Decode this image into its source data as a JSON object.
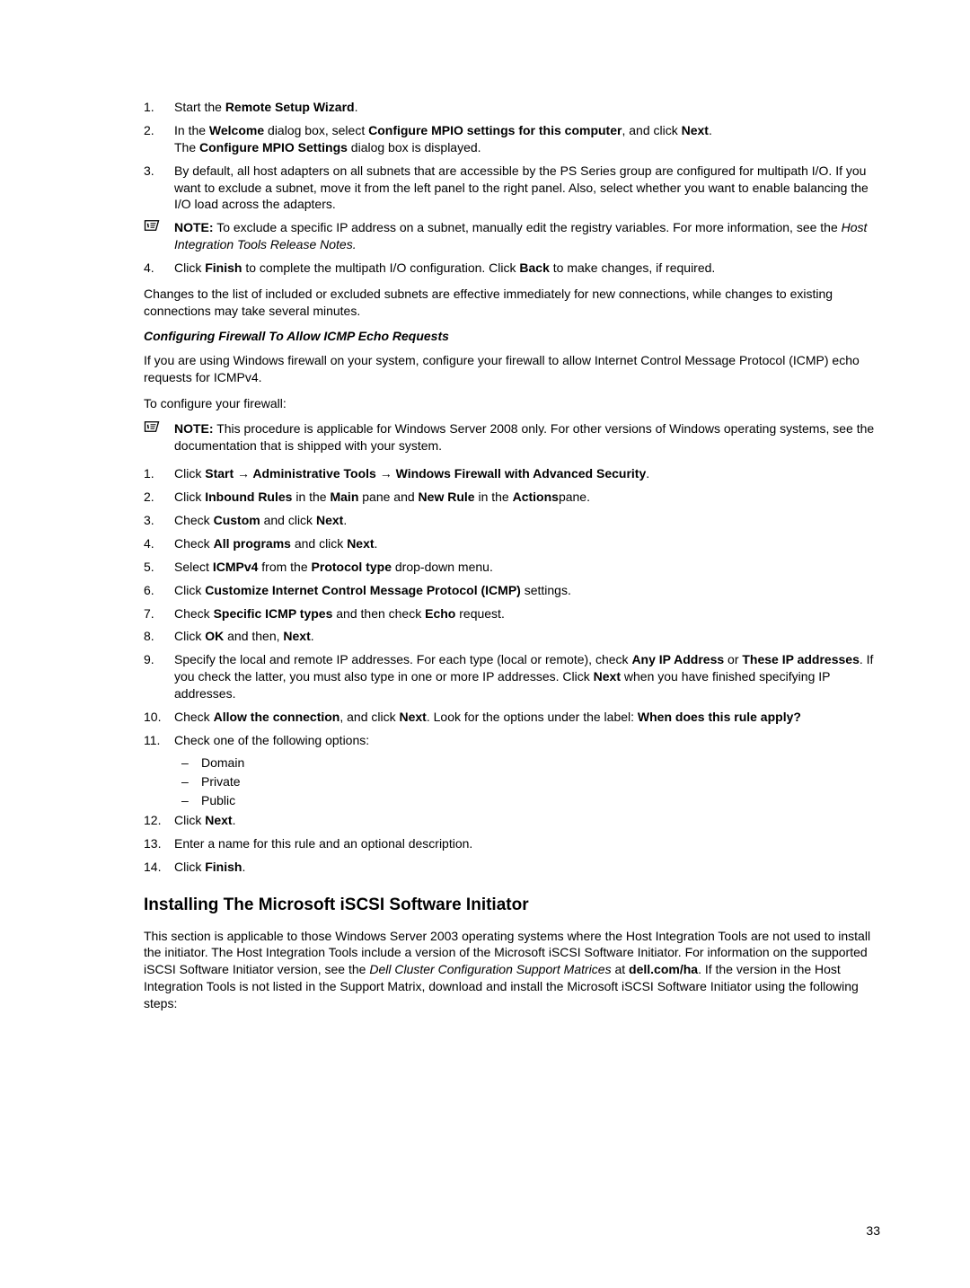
{
  "list_a": [
    {
      "n": "1.",
      "html": "Start the <b>Remote Setup Wizard</b>."
    },
    {
      "n": "2.",
      "html": "In the <b>Welcome</b> dialog box, select <b>Configure MPIO settings for this computer</b>, and click <b>Next</b>.<br>The <b>Configure MPIO Settings</b> dialog box is displayed."
    },
    {
      "n": "3.",
      "html": "By default, all host adapters on all subnets that are accessible by the PS Series group are configured for multipath I/O. If you want to exclude a subnet, move it from the left panel to the right panel. Also, select whether you want to enable balancing the I/O load across the adapters."
    }
  ],
  "note1": "<b>NOTE:</b> To exclude a specific IP address on a subnet, manually edit the registry variables. For more information, see the <span class=\"italic\">Host Integration Tools Release Notes.</span>",
  "list_a2": [
    {
      "n": "4.",
      "html": "Click <b>Finish</b> to complete the multipath I/O configuration. Click <b>Back</b> to make changes, if required."
    }
  ],
  "para1": "Changes to the list of included or excluded subnets are effective immediately for new connections, while changes to existing connections may take several minutes.",
  "h3a": "Configuring Firewall To Allow ICMP Echo Requests",
  "para2": "If you are using Windows firewall on your system, configure your firewall to allow Internet Control Message Protocol (ICMP) echo requests for ICMPv4.",
  "para3": "To configure your firewall:",
  "note2": "<b>NOTE:</b> This procedure is applicable for Windows Server 2008 only. For other versions of Windows operating systems, see the documentation that is shipped with your system.",
  "list_b": [
    {
      "n": "1.",
      "html": "Click <b>Start → Administrative Tools → Windows Firewall with Advanced Security</b>."
    },
    {
      "n": "2.",
      "html": "Click <b>Inbound Rules</b> in the <b>Main</b> pane and <b>New Rule</b> in the <b>Actions</b>pane."
    },
    {
      "n": "3.",
      "html": "Check <b>Custom</b> and click <b>Next</b>."
    },
    {
      "n": "4.",
      "html": "Check <b>All programs</b> and click <b>Next</b>."
    },
    {
      "n": "5.",
      "html": "Select <b>ICMPv4</b> from the <b>Protocol type</b> drop-down menu."
    },
    {
      "n": "6.",
      "html": "Click <b>Customize Internet Control Message Protocol (ICMP)</b> settings."
    },
    {
      "n": "7.",
      "html": "Check <b>Specific ICMP types</b> and then check <b>Echo</b> request."
    },
    {
      "n": "8.",
      "html": "Click <b>OK</b> and then, <b>Next</b>."
    },
    {
      "n": "9.",
      "html": "Specify the local and remote IP addresses. For each type (local or remote), check <b>Any IP Address</b> or <b>These IP addresses</b>. If you check the latter, you must also type in one or more IP addresses. Click <b>Next</b> when you have finished specifying IP addresses."
    },
    {
      "n": "10.",
      "html": "Check <b>Allow the connection</b>, and click <b>Next</b>. Look for the options under the label: <b>When does this rule apply?</b>"
    },
    {
      "n": "11.",
      "html": "Check one of the following options:"
    }
  ],
  "sublist": [
    "Domain",
    "Private",
    "Public"
  ],
  "list_b2": [
    {
      "n": "12.",
      "html": "Click <b>Next</b>."
    },
    {
      "n": "13.",
      "html": "Enter a name for this rule and an optional description."
    },
    {
      "n": "14.",
      "html": "Click <b>Finish</b>."
    }
  ],
  "h2a": "Installing The Microsoft iSCSI Software Initiator",
  "para4": "This section is applicable to those Windows Server 2003 operating systems where the Host Integration Tools are not used to install the initiator. The Host Integration Tools include a version of the Microsoft iSCSI Software Initiator. For information on the supported iSCSI Software Initiator version, see the <span class=\"italic\">Dell Cluster Configuration Support Matrices</span> at <b>dell.com/ha</b>. If the version in the Host Integration Tools is not listed in the Support Matrix, download and install the Microsoft iSCSI Software Initiator using the following steps:",
  "page_number": "33"
}
